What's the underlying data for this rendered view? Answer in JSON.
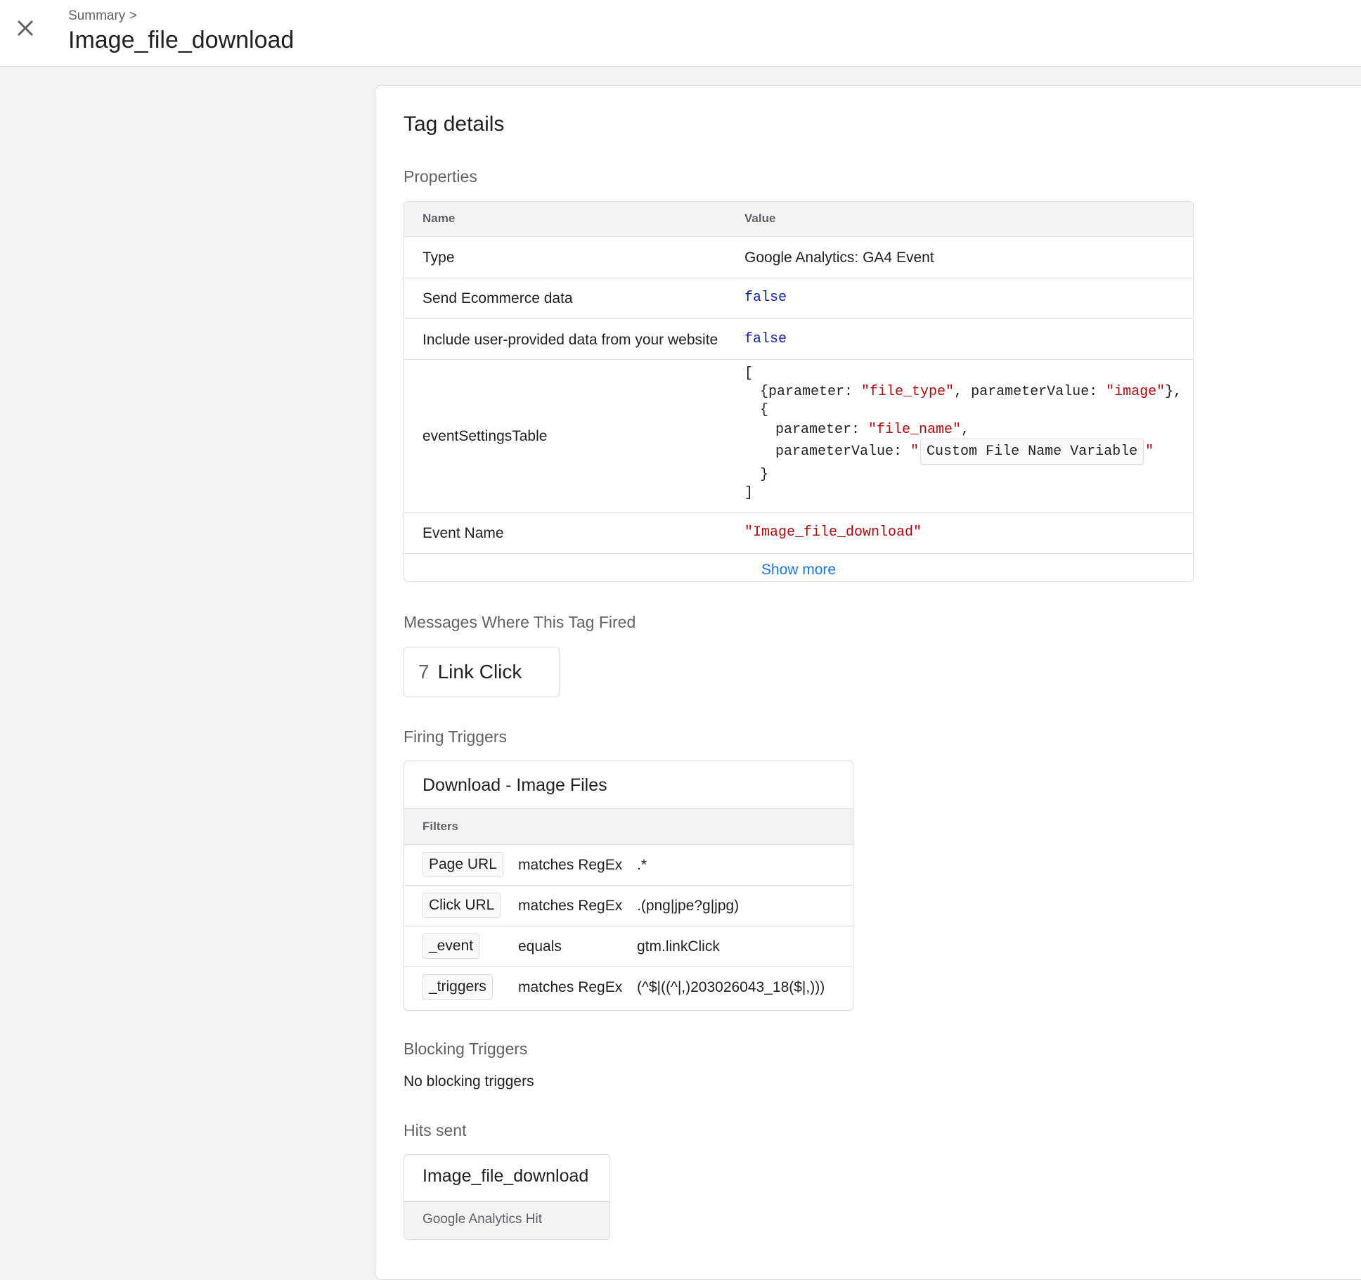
{
  "header": {
    "breadcrumb": "Summary >",
    "title": "Image_file_download",
    "close_icon": "close-icon"
  },
  "panel": {
    "title": "Tag details",
    "properties": {
      "section_title": "Properties",
      "col_name": "Name",
      "col_value": "Value",
      "rows": [
        {
          "name": "Type",
          "value": "Google Analytics: GA4 Event"
        },
        {
          "name": "Send Ecommerce data",
          "value": "false"
        },
        {
          "name": "Include user-provided data from your website",
          "value": "false"
        },
        {
          "name": "eventSettingsTable"
        },
        {
          "name": "Event Name",
          "value": "\"Image_file_download\""
        }
      ],
      "event_settings": {
        "open_bracket": "[",
        "l1_key": "{parameter: ",
        "l1_val": "\"file_type\"",
        "l1_mid": ", parameterValue: ",
        "l1_val2": "\"image\"",
        "l1_end": "},",
        "l2": "{",
        "l3_key": "parameter: ",
        "l3_val": "\"file_name\"",
        "l3_end": ",",
        "l4_key": "parameterValue: ",
        "l4_quote_open": "\"",
        "l4_var": "Custom File Name Variable",
        "l4_quote_close": "\"",
        "l5": "}",
        "close_bracket": "]"
      },
      "show_more": "Show more"
    },
    "messages": {
      "section_title": "Messages Where This Tag Fired",
      "items": [
        {
          "number": "7",
          "label": "Link Click"
        }
      ]
    },
    "firing_triggers": {
      "section_title": "Firing Triggers",
      "trigger_name": "Download - Image Files",
      "filters_label": "Filters",
      "filters": [
        {
          "variable": "Page URL",
          "operator": "matches RegEx",
          "value": ".*"
        },
        {
          "variable": "Click URL",
          "operator": "matches RegEx",
          "value": ".(png|jpe?g|jpg)"
        },
        {
          "variable": "_event",
          "operator": "equals",
          "value": "gtm.linkClick"
        },
        {
          "variable": "_triggers",
          "operator": "matches RegEx",
          "value": "(^$|((^|,)203026043_18($|,)))"
        }
      ]
    },
    "blocking_triggers": {
      "section_title": "Blocking Triggers",
      "text": "No blocking triggers"
    },
    "hits_sent": {
      "section_title": "Hits sent",
      "hit_title": "Image_file_download",
      "hit_type": "Google Analytics Hit"
    }
  }
}
